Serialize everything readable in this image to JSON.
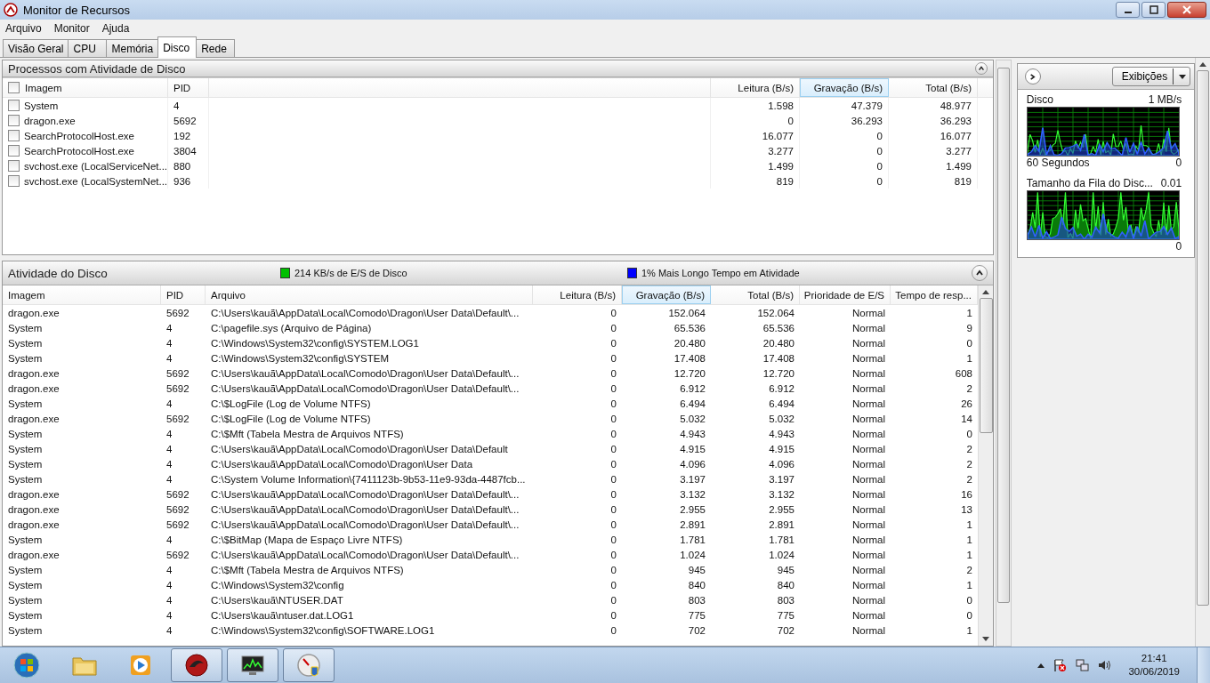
{
  "window": {
    "title": "Monitor de Recursos"
  },
  "menu": [
    "Arquivo",
    "Monitor",
    "Ajuda"
  ],
  "tabs": [
    {
      "label": "Visão Geral",
      "selected": false
    },
    {
      "label": "CPU",
      "selected": false
    },
    {
      "label": "Memória",
      "selected": false
    },
    {
      "label": "Disco",
      "selected": true
    },
    {
      "label": "Rede",
      "selected": false
    }
  ],
  "processes": {
    "title": "Processos com Atividade de Disco",
    "expanded": true,
    "columns": [
      {
        "label": "Imagem",
        "sorted": false
      },
      {
        "label": "PID",
        "sorted": false
      },
      {
        "label": "Leitura (B/s)",
        "sorted": false
      },
      {
        "label": "Gravação (B/s)",
        "sorted": true
      },
      {
        "label": "Total (B/s)",
        "sorted": false
      }
    ],
    "rows": [
      {
        "checked": false,
        "cells": [
          "System",
          "4",
          "1.598",
          "47.379",
          "48.977"
        ]
      },
      {
        "checked": false,
        "cells": [
          "dragon.exe",
          "5692",
          "0",
          "36.293",
          "36.293"
        ]
      },
      {
        "checked": false,
        "cells": [
          "SearchProtocolHost.exe",
          "192",
          "16.077",
          "0",
          "16.077"
        ]
      },
      {
        "checked": false,
        "cells": [
          "SearchProtocolHost.exe",
          "3804",
          "3.277",
          "0",
          "3.277"
        ]
      },
      {
        "checked": false,
        "cells": [
          "svchost.exe (LocalServiceNet...",
          "880",
          "1.499",
          "0",
          "1.499"
        ]
      },
      {
        "checked": false,
        "cells": [
          "svchost.exe (LocalSystemNet...",
          "936",
          "819",
          "0",
          "819"
        ]
      }
    ]
  },
  "activity": {
    "title": "Atividade do Disco",
    "expanded": true,
    "legend": [
      {
        "text": "214 KB/s de E/S de Disco",
        "color": "#00c000"
      },
      {
        "text": "1% Mais Longo Tempo em Atividade",
        "color": "#0000ff"
      }
    ],
    "columns": [
      {
        "label": "Imagem",
        "sorted": false
      },
      {
        "label": "PID",
        "sorted": false
      },
      {
        "label": "Arquivo",
        "sorted": false
      },
      {
        "label": "Leitura (B/s)",
        "sorted": false
      },
      {
        "label": "Gravação (B/s)",
        "sorted": true
      },
      {
        "label": "Total (B/s)",
        "sorted": false
      },
      {
        "label": "Prioridade de E/S",
        "sorted": false
      },
      {
        "label": "Tempo de resp...",
        "sorted": false
      }
    ],
    "rows": [
      [
        "dragon.exe",
        "5692",
        "C:\\Users\\kauã\\AppData\\Local\\Comodo\\Dragon\\User Data\\Default\\...",
        "0",
        "152.064",
        "152.064",
        "Normal",
        "1"
      ],
      [
        "System",
        "4",
        "C:\\pagefile.sys (Arquivo de Página)",
        "0",
        "65.536",
        "65.536",
        "Normal",
        "9"
      ],
      [
        "System",
        "4",
        "C:\\Windows\\System32\\config\\SYSTEM.LOG1",
        "0",
        "20.480",
        "20.480",
        "Normal",
        "0"
      ],
      [
        "System",
        "4",
        "C:\\Windows\\System32\\config\\SYSTEM",
        "0",
        "17.408",
        "17.408",
        "Normal",
        "1"
      ],
      [
        "dragon.exe",
        "5692",
        "C:\\Users\\kauã\\AppData\\Local\\Comodo\\Dragon\\User Data\\Default\\...",
        "0",
        "12.720",
        "12.720",
        "Normal",
        "608"
      ],
      [
        "dragon.exe",
        "5692",
        "C:\\Users\\kauã\\AppData\\Local\\Comodo\\Dragon\\User Data\\Default\\...",
        "0",
        "6.912",
        "6.912",
        "Normal",
        "2"
      ],
      [
        "System",
        "4",
        "C:\\$LogFile (Log de Volume NTFS)",
        "0",
        "6.494",
        "6.494",
        "Normal",
        "26"
      ],
      [
        "dragon.exe",
        "5692",
        "C:\\$LogFile (Log de Volume NTFS)",
        "0",
        "5.032",
        "5.032",
        "Normal",
        "14"
      ],
      [
        "System",
        "4",
        "C:\\$Mft (Tabela Mestra de Arquivos NTFS)",
        "0",
        "4.943",
        "4.943",
        "Normal",
        "0"
      ],
      [
        "System",
        "4",
        "C:\\Users\\kauã\\AppData\\Local\\Comodo\\Dragon\\User Data\\Default",
        "0",
        "4.915",
        "4.915",
        "Normal",
        "2"
      ],
      [
        "System",
        "4",
        "C:\\Users\\kauã\\AppData\\Local\\Comodo\\Dragon\\User Data",
        "0",
        "4.096",
        "4.096",
        "Normal",
        "2"
      ],
      [
        "System",
        "4",
        "C:\\System Volume Information\\{7411123b-9b53-11e9-93da-4487fcb...",
        "0",
        "3.197",
        "3.197",
        "Normal",
        "2"
      ],
      [
        "dragon.exe",
        "5692",
        "C:\\Users\\kauã\\AppData\\Local\\Comodo\\Dragon\\User Data\\Default\\...",
        "0",
        "3.132",
        "3.132",
        "Normal",
        "16"
      ],
      [
        "dragon.exe",
        "5692",
        "C:\\Users\\kauã\\AppData\\Local\\Comodo\\Dragon\\User Data\\Default\\...",
        "0",
        "2.955",
        "2.955",
        "Normal",
        "13"
      ],
      [
        "dragon.exe",
        "5692",
        "C:\\Users\\kauã\\AppData\\Local\\Comodo\\Dragon\\User Data\\Default\\...",
        "0",
        "2.891",
        "2.891",
        "Normal",
        "1"
      ],
      [
        "System",
        "4",
        "C:\\$BitMap (Mapa de Espaço Livre NTFS)",
        "0",
        "1.781",
        "1.781",
        "Normal",
        "1"
      ],
      [
        "dragon.exe",
        "5692",
        "C:\\Users\\kauã\\AppData\\Local\\Comodo\\Dragon\\User Data\\Default\\...",
        "0",
        "1.024",
        "1.024",
        "Normal",
        "1"
      ],
      [
        "System",
        "4",
        "C:\\$Mft (Tabela Mestra de Arquivos NTFS)",
        "0",
        "945",
        "945",
        "Normal",
        "2"
      ],
      [
        "System",
        "4",
        "C:\\Windows\\System32\\config",
        "0",
        "840",
        "840",
        "Normal",
        "1"
      ],
      [
        "System",
        "4",
        "C:\\Users\\kauã\\NTUSER.DAT",
        "0",
        "803",
        "803",
        "Normal",
        "0"
      ],
      [
        "System",
        "4",
        "C:\\Users\\kauã\\ntuser.dat.LOG1",
        "0",
        "775",
        "775",
        "Normal",
        "0"
      ],
      [
        "System",
        "4",
        "C:\\Windows\\System32\\config\\SOFTWARE.LOG1",
        "0",
        "702",
        "702",
        "Normal",
        "1"
      ]
    ]
  },
  "graphs_pane": {
    "views_button": "Exibições",
    "graphs": [
      {
        "title": "Disco",
        "max": "1 MB/s",
        "time": "60 Segundos",
        "min": "0"
      },
      {
        "title": "Tamanho da Fila do Disc...",
        "max": "0.01",
        "min": "0"
      }
    ]
  },
  "taskbar": {
    "items": [
      {
        "kind": "folder",
        "running": false
      },
      {
        "kind": "media",
        "running": false
      },
      {
        "kind": "browser",
        "running": true
      },
      {
        "kind": "monitor",
        "running": true
      },
      {
        "kind": "gauge",
        "running": true
      }
    ],
    "time": "21:41",
    "date": "30/06/2019"
  }
}
